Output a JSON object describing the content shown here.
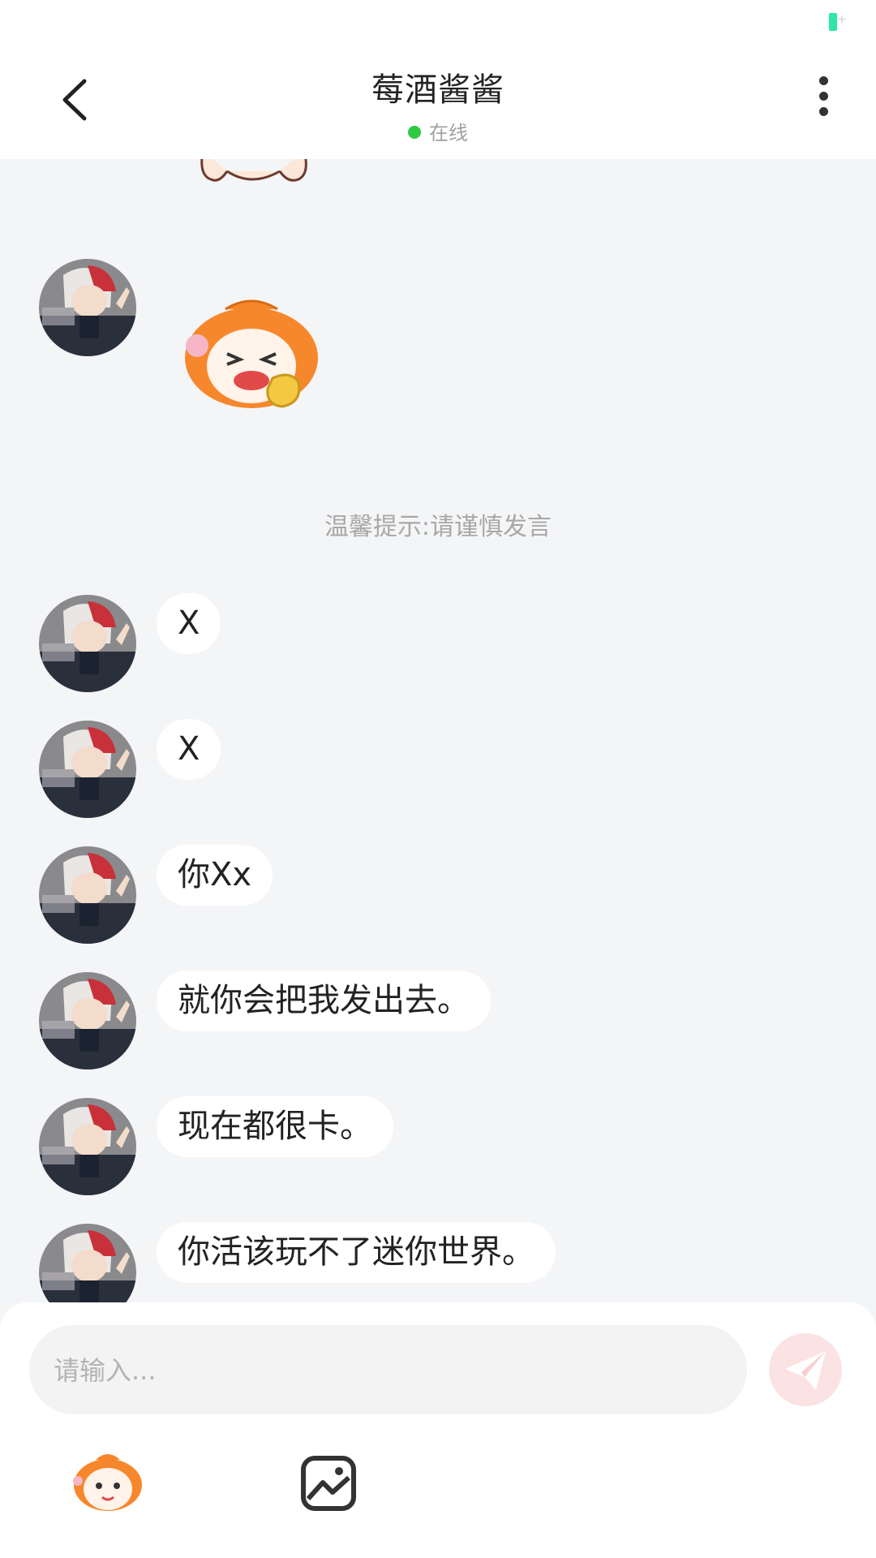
{
  "header": {
    "title": "莓酒酱酱",
    "status": "在线"
  },
  "chat": {
    "tip": "温馨提示:请谨慎发言",
    "messages": [
      {
        "text": "X"
      },
      {
        "text": "X"
      },
      {
        "text": "你Xx"
      },
      {
        "text": "就你会把我发出去。"
      },
      {
        "text": "现在都很卡。"
      },
      {
        "text": "你活该玩不了迷你世界。"
      }
    ]
  },
  "composer": {
    "placeholder": "请输入..."
  },
  "colors": {
    "online": "#30c942",
    "background": "#f4f5f7",
    "send_button": "#fbe3e3",
    "battery": "#2ee6a8"
  },
  "icons": [
    "back-arrow-icon",
    "more-dots-icon",
    "send-icon",
    "emoji-sticker-icon",
    "image-icon"
  ]
}
